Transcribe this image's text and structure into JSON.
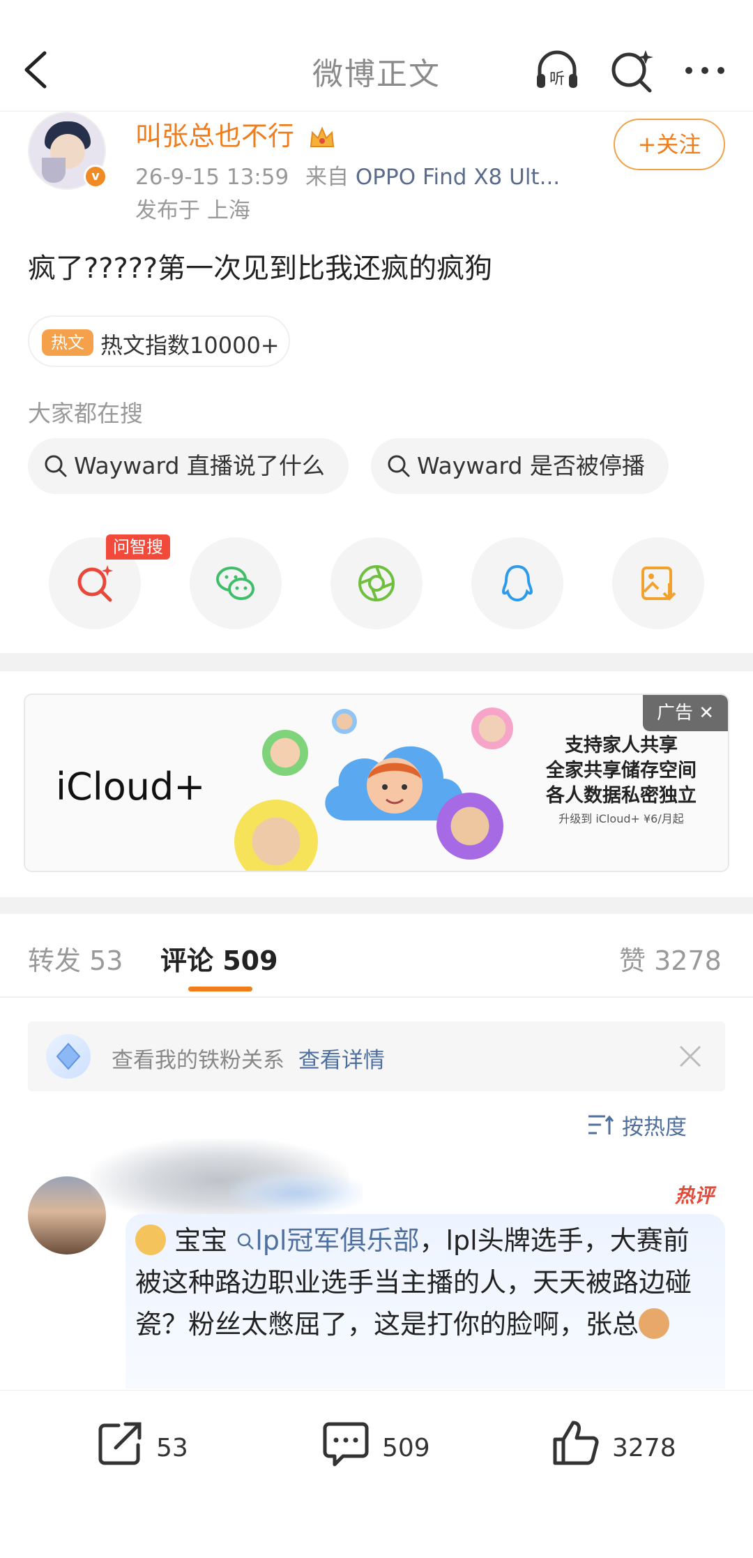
{
  "header": {
    "title": "微博正文"
  },
  "author": {
    "name": "叫张总也不行",
    "verified_mark": "v",
    "date": "26-9-15 13:59",
    "source_prefix": "来自",
    "source": "OPPO Find X8 Ult...",
    "location": "发布于 上海",
    "follow_label": "+关注"
  },
  "post": {
    "text": "疯了?????第一次见到比我还疯的疯狗",
    "hot_badge": "热文",
    "hot_index": "热文指数10000+"
  },
  "search": {
    "label": "大家都在搜",
    "chips": [
      "Wayward 直播说了什么",
      "Wayward 是否被停播"
    ]
  },
  "share": {
    "wenzhisou_badge": "问智搜",
    "icons": [
      "ai-search-icon",
      "wechat-icon",
      "moments-icon",
      "qq-icon",
      "save-image-icon"
    ]
  },
  "ad": {
    "tag": "广告",
    "brand": "iCloud+",
    "lines": [
      "支持家人共享",
      "全家共享储存空间",
      "各人数据私密独立"
    ],
    "small": "升级到 iCloud+ ¥6/月起"
  },
  "tabs": {
    "repost": "转发 53",
    "comments": "评论 509",
    "likes": "赞 3278"
  },
  "fan_banner": {
    "text": "查看我的铁粉关系",
    "link": "查看详情"
  },
  "sort": {
    "label": "按热度"
  },
  "comment": {
    "hot_tag": "热评",
    "prefix": "宝宝",
    "mention": "lpl冠军俱乐部",
    "body": "，lpl头牌选手，大赛前被这种路边职业选手当主播的人，天天被路边碰瓷？粉丝太憋屈了，这是打你的脸啊，张总"
  },
  "bottom_bar": {
    "repost_count": "53",
    "comment_count": "509",
    "like_count": "3278"
  },
  "colors": {
    "accent": "#f07c1c",
    "link": "#4f6f9f",
    "badge_red": "#f24a3a"
  }
}
